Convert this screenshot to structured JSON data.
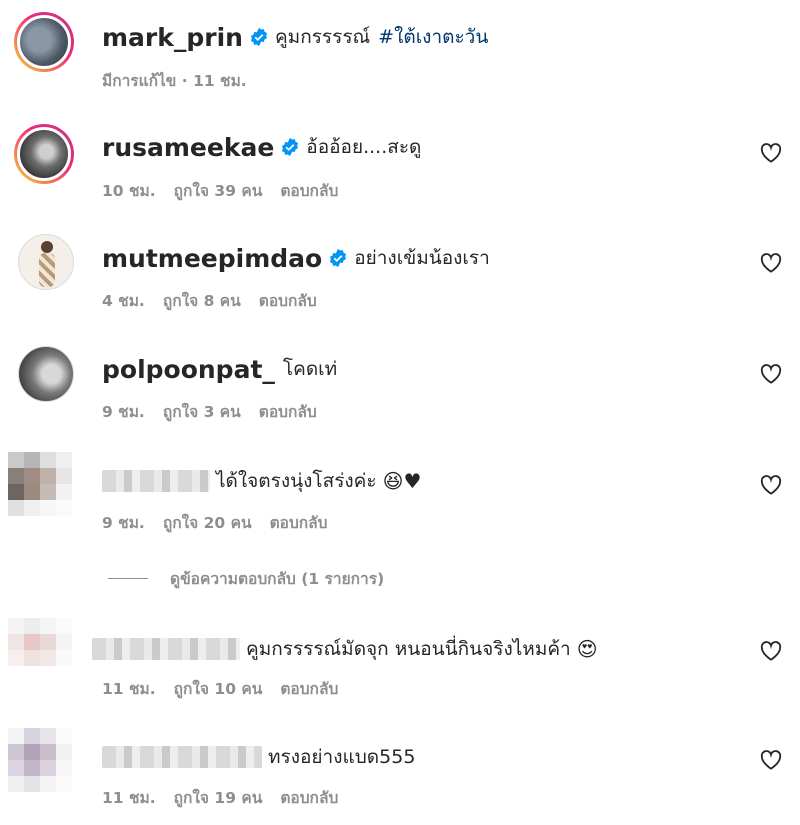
{
  "comments": [
    {
      "username": "mark_prin",
      "verified": true,
      "text": "คูมกรรรรณ์",
      "hashtag": "#ใต้เงาตะวัน",
      "meta": [
        "มีการแก้ไข · 11 ชม."
      ]
    },
    {
      "username": "rusameekae",
      "verified": true,
      "text": "อ้ออ้อย....สะดู",
      "meta": [
        "10 ชม.",
        "ถูกใจ 39 คน",
        "ตอบกลับ"
      ]
    },
    {
      "username": "mutmeepimdao",
      "verified": true,
      "text": "อย่างเข้มน้องเรา",
      "meta": [
        "4 ชม.",
        "ถูกใจ 8 คน",
        "ตอบกลับ"
      ]
    },
    {
      "username": "polpoonpat_",
      "verified": false,
      "text": "โคดเท่",
      "meta": [
        "9 ชม.",
        "ถูกใจ 3 คน",
        "ตอบกลับ"
      ]
    },
    {
      "text": "ได้ใจตรงนุ่งโสร่งค่ะ",
      "emoji": "😆♥",
      "meta": [
        "9 ชม.",
        "ถูกใจ 20 คน",
        "ตอบกลับ"
      ]
    },
    {
      "text": "คูมกรรรรณ์มัดจุก หนอนนี่กินจริงไหมค้า",
      "emoji": "😍",
      "meta": [
        "11 ชม.",
        "ถูกใจ 10 คน",
        "ตอบกลับ"
      ]
    },
    {
      "text": "ทรงอย่างแบด555",
      "meta": [
        "11 ชม.",
        "ถูกใจ 19 คน",
        "ตอบกลับ"
      ]
    }
  ],
  "view_replies": "ดูข้อความตอบกลับ (1 รายการ)",
  "colors": {
    "text": "#262626",
    "meta": "#8e8e8e",
    "verified": "#0095f6",
    "hashtag": "#00376b"
  },
  "icons": {
    "verified": "verified-badge-icon",
    "like": "heart-outline-icon"
  }
}
